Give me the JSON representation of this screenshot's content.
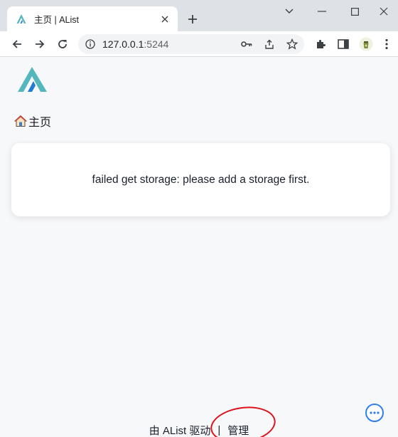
{
  "browser": {
    "tab": {
      "title": "主页 | AList"
    },
    "address_bar": {
      "url_host": "127.0.0.1",
      "url_port": ":5244"
    }
  },
  "page": {
    "breadcrumb": {
      "label": "主页"
    },
    "error_message": "failed get storage: please add a storage first.",
    "footer": {
      "powered_by": "由 AList 驱动",
      "separator": "|",
      "manage_link": "管理"
    }
  },
  "colors": {
    "logo_teal": "#54b7bd",
    "logo_blue": "#1f7bd6",
    "annotation_red": "#e0101a",
    "more_button": "#2f80ed"
  }
}
